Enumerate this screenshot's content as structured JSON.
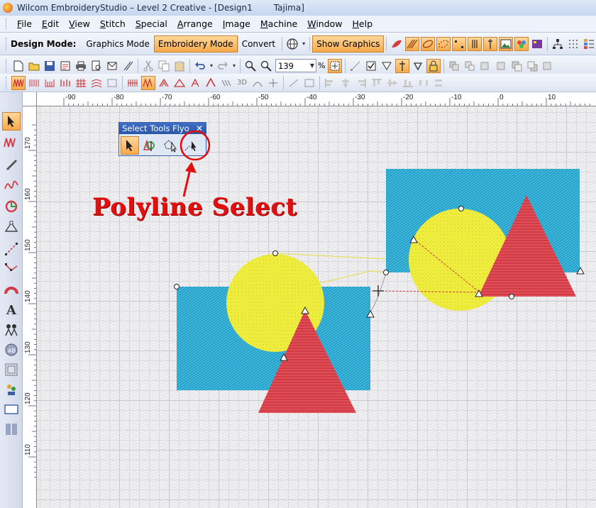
{
  "window": {
    "title": "Wilcom EmbroideryStudio – Level 2 Creative - [Design1",
    "title_machine": "Tajima]"
  },
  "menu": {
    "items": [
      {
        "label": "File",
        "icon": "file-menu"
      },
      {
        "label": "Edit"
      },
      {
        "label": "View"
      },
      {
        "label": "Stitch"
      },
      {
        "label": "Special"
      },
      {
        "label": "Arrange"
      },
      {
        "label": "Image"
      },
      {
        "label": "Machine"
      },
      {
        "label": "Window"
      },
      {
        "label": "Help"
      }
    ]
  },
  "toolbar": {
    "design_mode_label": "Design Mode:",
    "graphics_mode": "Graphics Mode",
    "embroidery_mode": "Embroidery Mode",
    "convert": "Convert",
    "show_graphics": "Show Graphics",
    "zoom_value": "139",
    "zoom_unit": "%"
  },
  "ruler": {
    "top_labels": [
      "-90",
      "-80",
      "-70",
      "-60",
      "-50",
      "-40",
      "-30",
      "-20",
      "-10",
      "0",
      "10"
    ],
    "left_labels": [
      "170",
      "160",
      "150",
      "140",
      "130",
      "120",
      "110"
    ]
  },
  "flyout": {
    "title": "Select Tools Flyo",
    "close": "✕",
    "tools": [
      "select-object-tool",
      "select-by-color-tool",
      "polygon-select-tool",
      "polyline-select-tool"
    ]
  },
  "annotation": {
    "label": "Polyline Select",
    "color": "#e30f0f"
  },
  "colors": {
    "accent_orange": "#f7a94a",
    "fill_blue": "#1f9fc9",
    "fill_yellow": "#f2ee3c",
    "fill_red": "#d23a44"
  }
}
